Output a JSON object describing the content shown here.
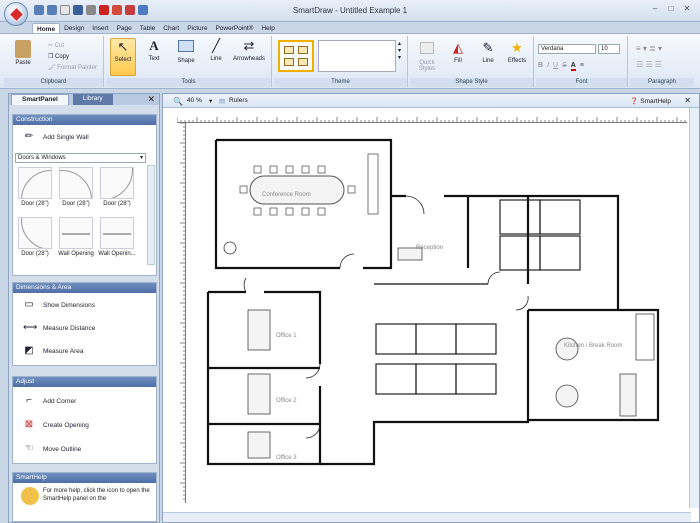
{
  "window": {
    "title": "SmartDraw - Untitled Example 1"
  },
  "tabs": [
    "Home",
    "Design",
    "Insert",
    "Page",
    "Table",
    "Chart",
    "Picture",
    "PowerPoint®",
    "Help"
  ],
  "ribbon": {
    "clipboard": {
      "label": "Clipboard",
      "paste": "Paste",
      "cut": "Cut",
      "copy": "Copy",
      "format_painter": "Format Painter"
    },
    "tools": {
      "label": "Tools",
      "select": "Select",
      "text": "Text",
      "shape": "Shape",
      "line": "Line",
      "arrowheads": "Arrowheads"
    },
    "theme": {
      "label": "Theme"
    },
    "shape_style": {
      "label": "Shape Style",
      "quick_styles": "Quick Styles",
      "fill": "Fill",
      "line": "Line",
      "effects": "Effects"
    },
    "font": {
      "label": "Font",
      "face": "Verdana",
      "size": "10",
      "bold": "B",
      "italic": "I",
      "underline": "U",
      "strike": "S"
    },
    "paragraph": {
      "label": "Paragraph"
    }
  },
  "smartpanel": {
    "tab_panel": "SmartPanel",
    "tab_library": "Library",
    "construction": {
      "header": "Construction",
      "add_wall": "Add Single Wall",
      "dropdown": "Doors & Windows",
      "shapes": [
        "Door (28\")",
        "Door (28\")",
        "Door (28\")",
        "Door (28\")",
        "Wall Opening",
        "Wall Openin..."
      ]
    },
    "dimensions": {
      "header": "Dimensions & Area",
      "items": [
        "Show Dimensions",
        "Measure Distance",
        "Measure Area"
      ]
    },
    "adjust": {
      "header": "Adjust",
      "items": [
        "Add Corner",
        "Create Opening",
        "Move Outline"
      ]
    },
    "smarthelp": {
      "header": "SmartHelp",
      "text": "For more help, click the icon to open the SmartHelp panel on the"
    }
  },
  "canvas": {
    "zoom": "40 %",
    "rulers": "Rulers",
    "smarthelp": "SmartHelp"
  },
  "floorplan": {
    "rooms": {
      "conference": "Conference Room",
      "reception": "Reception",
      "office1": "Office 1",
      "office2": "Office 2",
      "office3": "Office 3",
      "kitchen": "Kitchen / Break Room"
    }
  },
  "colors": {
    "accent": "#4e6fa6",
    "selection": "#ffc94d",
    "logo": "#d72a2a"
  }
}
